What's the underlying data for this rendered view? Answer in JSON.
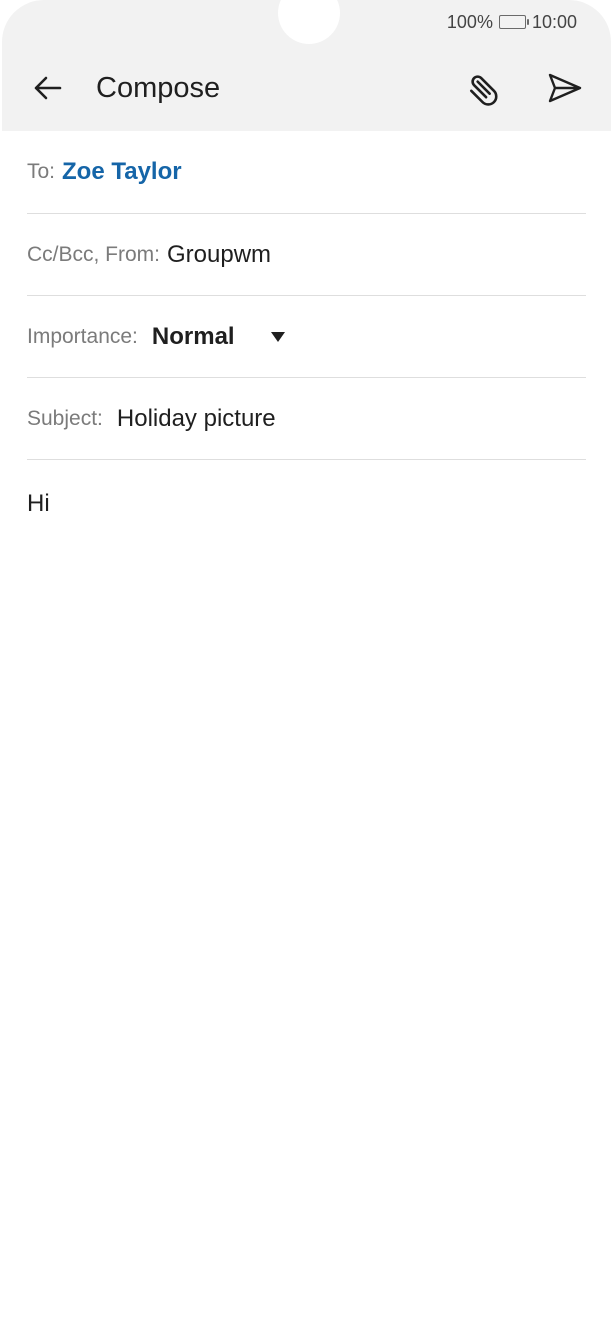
{
  "status_bar": {
    "battery_percent": "100%",
    "battery_level": 1.0,
    "time": "10:00"
  },
  "toolbar": {
    "title": "Compose",
    "back_icon": "arrow-left-icon",
    "attach_icon": "paperclip-icon",
    "send_icon": "send-icon"
  },
  "form": {
    "to_label": "To:",
    "to_value": "Zoe Taylor",
    "ccbcc_label": "Cc/Bcc, From:",
    "from_value": "Groupwm",
    "importance_label": "Importance:",
    "importance_value": "Normal",
    "subject_label": "Subject:",
    "subject_value": "Holiday picture"
  },
  "body": {
    "text": "Hi"
  },
  "colors": {
    "accent": "#1565a8",
    "header_bg": "#f2f2f2",
    "divider": "#dedede",
    "label": "#7b7b7b",
    "text": "#1f1f1f"
  }
}
